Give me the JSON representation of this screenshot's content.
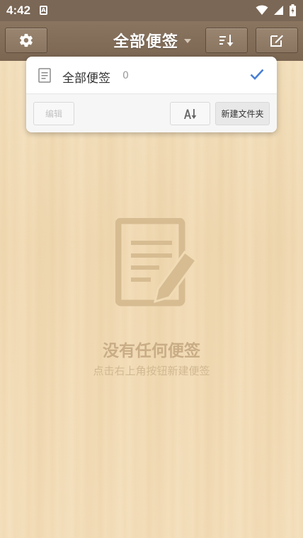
{
  "status_bar": {
    "time": "4:42",
    "notification_glyph": "A",
    "icons": [
      "wifi-icon",
      "signal-icon",
      "battery-icon"
    ]
  },
  "toolbar": {
    "title": "全部便签",
    "settings_icon": "gear-icon",
    "sort_icon": "sort-icon",
    "new_note_icon": "edit-icon"
  },
  "folder_panel": {
    "folders": [
      {
        "name": "全部便签",
        "count": "0",
        "selected": true
      }
    ],
    "edit_label": "编辑",
    "sort_icon": "sort-alpha-icon",
    "new_folder_label": "新建文件夹"
  },
  "empty_state": {
    "icon": "note-pencil-icon",
    "title": "没有任何便签",
    "subtitle": "点击右上角按钮新建便签"
  },
  "colors": {
    "toolbar": "#7b6652",
    "status_bar": "#7a6755",
    "accent_check": "#4a7fd6",
    "empty_text": "#c9ad86"
  }
}
